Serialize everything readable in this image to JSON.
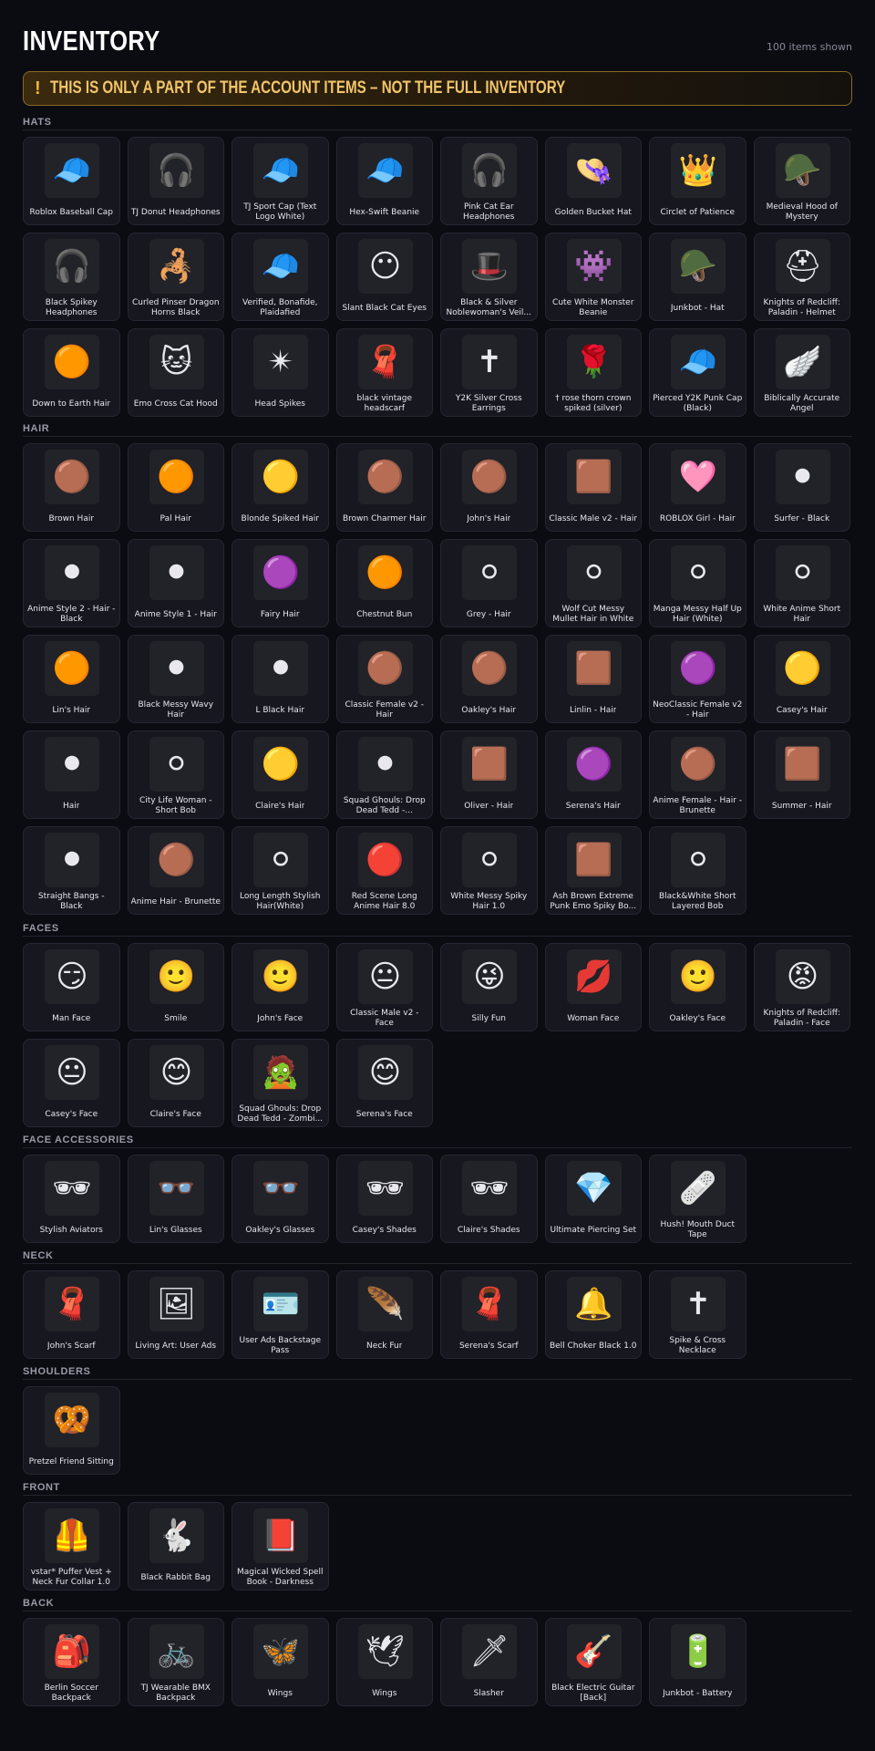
{
  "header": {
    "title": "INVENTORY",
    "count": "100 items shown"
  },
  "banner": {
    "icon": "!",
    "text": "THIS IS ONLY A PART OF THE ACCOUNT ITEMS – NOT THE FULL INVENTORY"
  },
  "sections": [
    {
      "title": "HATS",
      "items": [
        {
          "name": "Roblox Baseball Cap",
          "icon": "🧢",
          "tint": "#222"
        },
        {
          "name": "TJ Donut Headphones",
          "icon": "🎧",
          "tint": "#d9b3e8"
        },
        {
          "name": "TJ Sport Cap (Text Logo White)",
          "icon": "🧢",
          "tint": "#eee"
        },
        {
          "name": "Hex-Swift Beanie",
          "icon": "🧢",
          "tint": "#334"
        },
        {
          "name": "Pink Cat Ear Headphones",
          "icon": "🎧",
          "tint": "#e0287a"
        },
        {
          "name": "Golden Bucket Hat",
          "icon": "👒",
          "tint": "#d9a91a"
        },
        {
          "name": "Circlet of Patience",
          "icon": "👑",
          "tint": "#e6c04a"
        },
        {
          "name": "Medieval Hood of Mystery",
          "icon": "🪖",
          "tint": "#5a7a2a"
        },
        {
          "name": "Black Spikey Headphones",
          "icon": "🎧",
          "tint": "#222"
        },
        {
          "name": "Curled Pinser Dragon Horns Black",
          "icon": "🦂",
          "tint": "#222"
        },
        {
          "name": "Verified, Bonafide, Plaidafied",
          "icon": "🧢",
          "tint": "#4a8a5a"
        },
        {
          "name": "Slant Black Cat Eyes",
          "icon": "😶",
          "tint": "#eee"
        },
        {
          "name": "Black & Silver Noblewoman's Veil...",
          "icon": "🎩",
          "tint": "#222"
        },
        {
          "name": "Cute White Monster Beanie",
          "icon": "👾",
          "tint": "#ddd"
        },
        {
          "name": "Junkbot - Hat",
          "icon": "🪖",
          "tint": "#c9b03a"
        },
        {
          "name": "Knights of Redcliff: Paladin - Helmet",
          "icon": "⛑",
          "tint": "#8a2a1a"
        }
      ]
    },
    {
      "title": "",
      "items": [
        {
          "name": "Down to Earth Hair",
          "icon": "🧶",
          "tint": "#a8442a"
        },
        {
          "name": "Emo Cross Cat Hood",
          "icon": "🐱",
          "tint": "#333"
        },
        {
          "name": "Head Spikes",
          "icon": "✴",
          "tint": "#ccc"
        },
        {
          "name": "black vintage headscarf",
          "icon": "🧣",
          "tint": "#222"
        },
        {
          "name": "Y2K Silver Cross Earrings",
          "icon": "✝",
          "tint": "#999"
        },
        {
          "name": "† rose thorn crown spiked (silver)",
          "icon": "🌹",
          "tint": "#bbb"
        },
        {
          "name": "Pierced Y2K Punk Cap (Black)",
          "icon": "🧢",
          "tint": "#333"
        },
        {
          "name": "Biblically Accurate Angel",
          "icon": "🪽",
          "tint": "#ddd"
        }
      ]
    }
  ],
  "groups": [
    {
      "title": "HATS",
      "start": 0
    },
    {
      "title": "HAIR"
    },
    {
      "title": "FACES"
    },
    {
      "title": "FACE ACCESSORIES"
    },
    {
      "title": "NECK"
    },
    {
      "title": "SHOULDERS"
    },
    {
      "title": "FRONT"
    },
    {
      "title": "BACK"
    }
  ],
  "hats": [
    "Roblox Baseball Cap",
    "TJ Donut Headphones",
    "TJ Sport Cap (Text Logo White)",
    "Hex-Swift Beanie",
    "Pink Cat Ear Headphones",
    "Golden Bucket Hat",
    "Circlet of Patience",
    "Medieval Hood of Mystery",
    "Black Spikey Headphones",
    "Curled Pinser Dragon Horns Black",
    "Verified, Bonafide, Plaidafied",
    "Slant Black Cat Eyes",
    "Black & Silver Noblewoman's Veil...",
    "Cute White Monster Beanie",
    "Junkbot - Hat",
    "Knights of Redcliff: Paladin - Helmet",
    "Down to Earth Hair",
    "Emo Cross Cat Hood",
    "Head Spikes",
    "black vintage headscarf",
    "Y2K Silver Cross Earrings",
    "† rose thorn crown spiked (silver)",
    "Pierced Y2K Punk Cap (Black)",
    "Biblically Accurate Angel"
  ],
  "hair": [
    "Brown Hair",
    "Pal Hair",
    "Blonde Spiked Hair",
    "Brown Charmer Hair",
    "John's Hair",
    "Classic Male v2 - Hair",
    "ROBLOX Girl - Hair",
    "Surfer - Black",
    "Anime Style 2 - Hair - Black",
    "Anime Style 1 - Hair",
    "Fairy Hair",
    "Chestnut Bun",
    "Grey - Hair",
    "Wolf Cut Messy Mullet Hair in White",
    "Manga Messy Half Up Hair (White)",
    "White Anime Short Hair",
    "Lin's Hair",
    "Black Messy Wavy Hair",
    "L Black Hair",
    "Classic Female v2 - Hair",
    "Oakley's Hair",
    "Linlin - Hair",
    "NeoClassic Female v2 - Hair",
    "Casey's Hair",
    "Hair",
    "City Life Woman - Short Bob",
    "Claire's Hair",
    "Squad Ghouls: Drop Dead Tedd -...",
    "Oliver - Hair",
    "Serena's Hair",
    "Anime Female - Hair - Brunette",
    "Summer - Hair",
    "Straight Bangs - Black",
    "Anime Hair - Brunette",
    "Long Length Stylish Hair(White)",
    "Red Scene Long Anime Hair 8.0",
    "White Messy Spiky Hair 1.0",
    "Ash Brown Extreme Punk Emo Spiky Bo...",
    "Black&White Short Layered Bob"
  ],
  "faces": [
    "Man Face",
    "Smile",
    "John's Face",
    "Classic Male v2 - Face",
    "Silly Fun",
    "Woman Face",
    "Oakley's Face",
    "Knights of Redcliff: Paladin - Face",
    "Casey's Face",
    "Claire's Face",
    "Squad Ghouls: Drop Dead Tedd - Zombi...",
    "Serena's Face"
  ],
  "face_accessories": [
    "Stylish Aviators",
    "Lin's Glasses",
    "Oakley's Glasses",
    "Casey's Shades",
    "Claire's Shades",
    "Ultimate Piercing Set",
    "Hush! Mouth Duct Tape"
  ],
  "neck": [
    "John's Scarf",
    "Living Art: User Ads",
    "User Ads Backstage Pass",
    "Neck Fur",
    "Serena's Scarf",
    "Bell Choker Black 1.0",
    "Spike & Cross Necklace"
  ],
  "shoulders": [
    "Pretzel Friend Sitting"
  ],
  "front": [
    "vstar* Puffer Vest + Neck Fur Collar 1.0",
    "Black Rabbit Bag",
    "Magical Wicked Spell Book - Darkness"
  ],
  "back": [
    "Berlin Soccer Backpack",
    "TJ Wearable BMX Backpack",
    "Wings",
    "Wings",
    "Slasher",
    "Black Electric Guitar [Back]",
    "Junkbot - Battery"
  ],
  "icons": {
    "hats": [
      "🧢",
      "🎧",
      "🧢",
      "🧢",
      "🎧",
      "👒",
      "👑",
      "🪖",
      "🎧",
      "🦂",
      "🧢",
      "😶",
      "🎩",
      "👾",
      "🪖",
      "⛑",
      "🟠",
      "🐱",
      "✴",
      "🧣",
      "✝",
      "🌹",
      "🧢",
      "🪽"
    ],
    "hair": [
      "🟤",
      "🟠",
      "🟡",
      "🟤",
      "🟤",
      "🟫",
      "🩷",
      "⚫",
      "⚫",
      "⚫",
      "🟣",
      "🟠",
      "⚪",
      "⚪",
      "⚪",
      "⚪",
      "🟠",
      "⚫",
      "⚫",
      "🟤",
      "🟤",
      "🟫",
      "🟣",
      "🟡",
      "⚫",
      "⚪",
      "🟡",
      "⚫",
      "🟫",
      "🟣",
      "🟤",
      "🟫",
      "⚫",
      "🟤",
      "⚪",
      "🔴",
      "⚪",
      "🟫",
      "⚪"
    ],
    "faces": [
      "😏",
      "🙂",
      "🙂",
      "😐",
      "😜",
      "💋",
      "🙂",
      "😡",
      "😐",
      "😊",
      "🧟",
      "😊"
    ],
    "face_accessories": [
      "🕶",
      "👓",
      "👓",
      "🕶",
      "🕶",
      "💎",
      "🩹"
    ],
    "neck": [
      "🧣",
      "🖼",
      "🪪",
      "🪶",
      "🧣",
      "🔔",
      "✝"
    ],
    "shoulders": [
      "🥨"
    ],
    "front": [
      "🦺",
      "🐇",
      "📕"
    ],
    "back": [
      "🎒",
      "🚲",
      "🦋",
      "🕊",
      "🗡",
      "🎸",
      "🔋"
    ]
  }
}
